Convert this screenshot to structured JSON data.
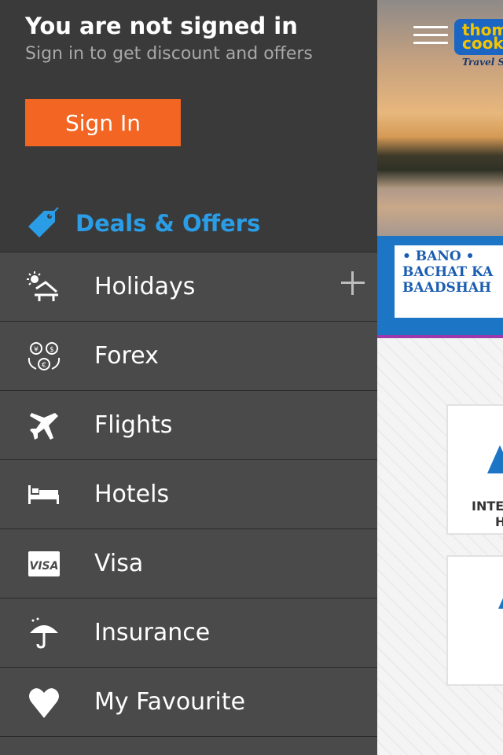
{
  "header": {
    "title": "You are not signed in",
    "subtitle": "Sign in to get discount and offers",
    "signin_label": "Sign In"
  },
  "deals": {
    "label": "Deals & Offers",
    "icon": "tag-icon",
    "color": "#2a9de6"
  },
  "menu": {
    "items": [
      {
        "label": "Holidays",
        "icon": "beach-chair-sun-icon",
        "expandable": true
      },
      {
        "label": "Forex",
        "icon": "currency-exchange-icon"
      },
      {
        "label": "Flights",
        "icon": "airplane-icon"
      },
      {
        "label": "Hotels",
        "icon": "bed-icon"
      },
      {
        "label": "Visa",
        "icon": "visa-card-icon"
      },
      {
        "label": "Insurance",
        "icon": "umbrella-icon"
      },
      {
        "label": "My Favourite",
        "icon": "heart-icon"
      }
    ]
  },
  "background_app": {
    "logo_text": "thomas cook",
    "logo_tagline": "Travel S",
    "banner_lines": [
      "• BANO •",
      "BACHAT KA",
      "BAADSHAH"
    ],
    "card1_text": [
      "INTE",
      "H"
    ],
    "accent": "#1d75c6",
    "signin_color": "#f26522"
  }
}
